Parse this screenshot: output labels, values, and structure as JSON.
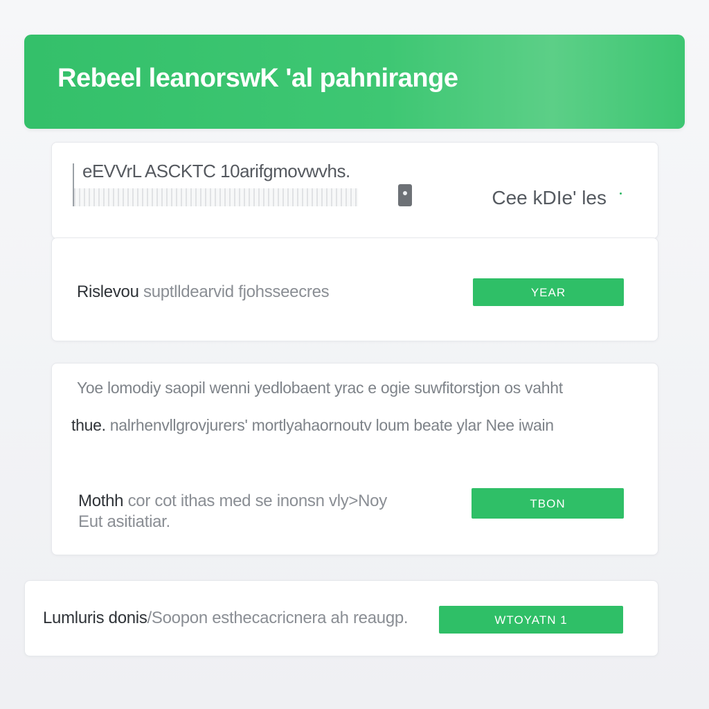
{
  "header": {
    "title": "Rebeel leanorswK 'al pahnirange"
  },
  "search_card": {
    "query_text": "eEVVrL ASCKTC  10arifgmovwvhs.",
    "side_link": "Cee kDIe' les"
  },
  "row_1": {
    "label_bold": "Rislevou",
    "label_rest": " suptlldearvid fjohsseecres",
    "button_label": "YEAR"
  },
  "row_2": {
    "para_1": "Yoe lomodiy saopil wenni yedlobaent yrac e ogie suwfitorstjon os vahht",
    "para_2_bold": "thue.",
    "para_2_rest": " nalrhenvllgrovjurers' mortlyahaornoutv loum beate ylar Nee iwain",
    "label_bold": "Mothh",
    "label_line_1": " cor cot ithas med se inonsn vly>Noy",
    "label_line_2": "Eut asitiatiar.",
    "button_label": "TBON"
  },
  "row_3": {
    "label_bold": "Lumluris donis",
    "label_rest": "/Soopon esthecacricnera ah reaugp.",
    "button_label": "WTOYATN 1"
  },
  "colors": {
    "accent": "#2fbf67",
    "header_gradient_start": "#34c06a",
    "card_bg": "#ffffff",
    "page_bg": "#f2f3f6"
  }
}
